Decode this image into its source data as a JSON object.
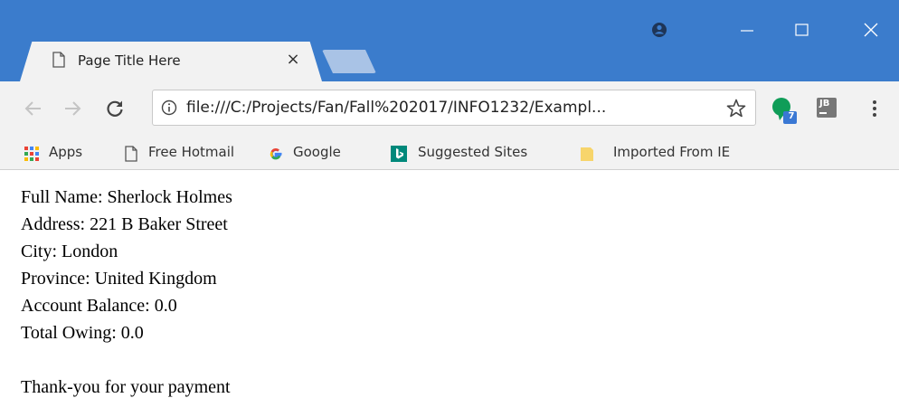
{
  "browser": {
    "tab": {
      "title": "Page Title Here",
      "close_label": "×"
    },
    "address_bar": {
      "url": "file:///C:/Projects/Fan/Fall%202017/INFO1232/Exampl..."
    },
    "extensions": {
      "hangouts_badge": "7",
      "jb_label": "JB"
    },
    "bookmarks": [
      {
        "label": "Apps",
        "icon": "apps-grid-icon"
      },
      {
        "label": "Free Hotmail",
        "icon": "document-icon"
      },
      {
        "label": "Google",
        "icon": "google-g-icon"
      },
      {
        "label": "Suggested Sites",
        "icon": "bing-icon"
      },
      {
        "label": "Imported From IE",
        "icon": "folder-icon"
      }
    ],
    "colors": {
      "titlebar": "#3b7ccc",
      "toolbar": "#f2f2f2",
      "hangouts_green": "#0f9d58",
      "badge_blue": "#3a78d4"
    }
  },
  "page": {
    "lines": [
      "Full Name: Sherlock Holmes",
      "Address: 221 B Baker Street",
      "City: London",
      "Province: United Kingdom",
      "Account Balance: 0.0",
      "Total Owing: 0.0"
    ],
    "message": "Thank-you for your payment"
  }
}
